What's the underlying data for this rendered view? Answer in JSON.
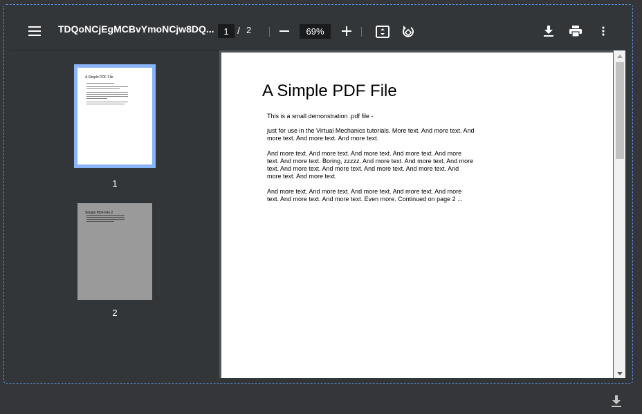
{
  "toolbar": {
    "title": "TDQoNCjEgMCBvYmoNCjw8DQ...",
    "current_page": "1",
    "page_separator": "/",
    "total_pages": "2",
    "zoom": "69%"
  },
  "sidebar": {
    "thumbnails": [
      {
        "label": "1",
        "mini_title": "A Simple PDF File"
      },
      {
        "label": "2",
        "mini_title": "Simple PDF File 2"
      }
    ]
  },
  "document": {
    "title": "A Simple PDF File",
    "paragraphs": [
      "This is a small demonstration .pdf file -",
      "just for use in the Virtual Mechanics tutorials. More text. And more text. And more text. And more text. And more text.",
      "And more text. And more text. And more text. And more text. And more text. And more text. Boring, zzzzz. And more text. And more text. And more text. And more text. And more text. And more text. And more text. And more text. And more text.",
      "And more text. And more text. And more text. And more text. And more text. And more text. And more text. Even more. Continued on page 2 ..."
    ]
  },
  "colors": {
    "toolbar_bg": "#323639",
    "viewer_bg": "#525659",
    "selection_accent": "#8ab4f8"
  },
  "icons": [
    "menu-icon",
    "zoom-out-icon",
    "zoom-in-icon",
    "fit-page-icon",
    "rotate-icon",
    "download-icon",
    "print-icon",
    "more-vert-icon"
  ]
}
